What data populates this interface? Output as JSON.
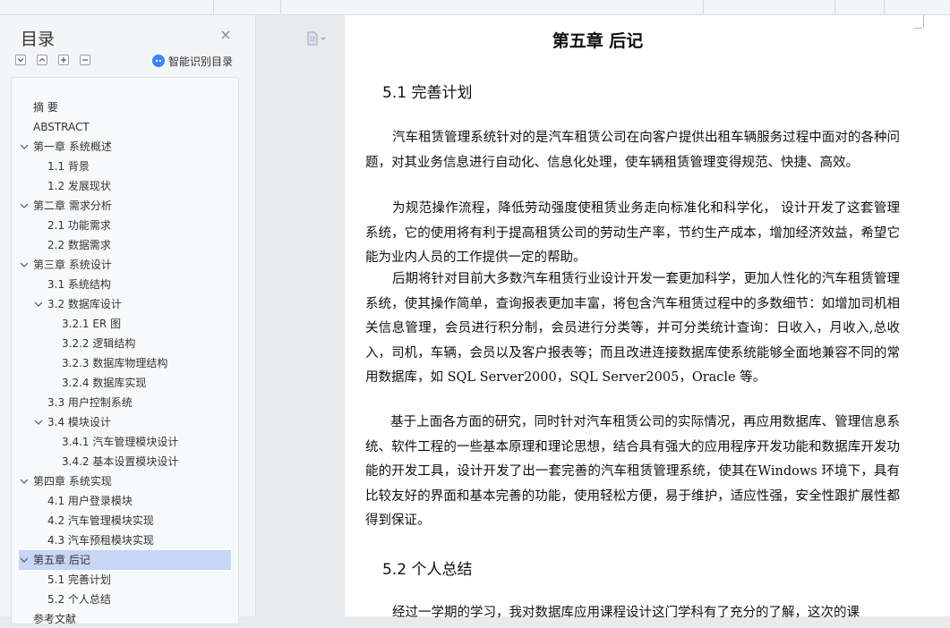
{
  "sidebar": {
    "title": "目录",
    "smart_toc_label": "智能识别目录",
    "items": [
      {
        "label": "摘    要",
        "level": 0,
        "expandable": false
      },
      {
        "label": "ABSTRACT",
        "level": 0,
        "expandable": false
      },
      {
        "label": "第一章  系统概述",
        "level": 0,
        "expandable": true
      },
      {
        "label": "1.1 背景",
        "level": 1,
        "expandable": false
      },
      {
        "label": "1.2 发展现状",
        "level": 1,
        "expandable": false
      },
      {
        "label": "第二章  需求分析",
        "level": 0,
        "expandable": true
      },
      {
        "label": "2.1  功能需求",
        "level": 1,
        "expandable": false
      },
      {
        "label": "2.2  数据需求",
        "level": 1,
        "expandable": false
      },
      {
        "label": "第三章  系统设计",
        "level": 0,
        "expandable": true
      },
      {
        "label": "3.1 系统结构",
        "level": 1,
        "expandable": false
      },
      {
        "label": "3.2  数据库设计",
        "level": 1,
        "expandable": true
      },
      {
        "label": "3.2.1 ER 图",
        "level": 2,
        "expandable": false
      },
      {
        "label": "3.2.2  逻辑结构",
        "level": 2,
        "expandable": false
      },
      {
        "label": "3.2.3  数据库物理结构",
        "level": 2,
        "expandable": false
      },
      {
        "label": "3.2.4  数据库实现",
        "level": 2,
        "expandable": false
      },
      {
        "label": "3.3 用户控制系统",
        "level": 1,
        "expandable": false
      },
      {
        "label": "3.4 模块设计",
        "level": 1,
        "expandable": true
      },
      {
        "label": "3.4.1  汽车管理模块设计",
        "level": 2,
        "expandable": false
      },
      {
        "label": "3.4.2  基本设置模块设计",
        "level": 2,
        "expandable": false
      },
      {
        "label": "第四章  系统实现",
        "level": 0,
        "expandable": true
      },
      {
        "label": "4.1 用户登录模块",
        "level": 1,
        "expandable": false
      },
      {
        "label": "4.2 汽车管理模块实现",
        "level": 1,
        "expandable": false
      },
      {
        "label": "4.3 汽车预租模块实现",
        "level": 1,
        "expandable": false
      },
      {
        "label": "第五章  后记",
        "level": 0,
        "expandable": true,
        "active": true
      },
      {
        "label": "5.1 完善计划",
        "level": 1,
        "expandable": false
      },
      {
        "label": "5.2 个人总结",
        "level": 1,
        "expandable": false
      },
      {
        "label": "参考文献",
        "level": 0,
        "expandable": false
      }
    ]
  },
  "document": {
    "chapter_title": "第五章  后记",
    "sec1_title": "5.1 完善计划",
    "para1": "汽车租赁管理系统针对的是汽车租赁公司在向客户提供出租车辆服务过程中面对的各种问题，对其业务信息进行自动化、信息化处理，使车辆租赁管理变得规范、快捷、高效。",
    "para2": "为规范操作流程，降低劳动强度使租赁业务走向标准化和科学化，  设计开发了这套管理系统，它的使用将有利于提高租赁公司的劳动生产率，节约生产成本，增加经济效益，希望它能为业内人员的工作提供一定的帮助。",
    "para3": "后期将针对目前大多数汽车租赁行业设计开发一套更加科学，更加人性化的汽车租赁管理系统，使其操作简单，查询报表更加丰富，将包含汽车租赁过程中的多数细节：如增加司机相关信息管理，会员进行积分制，会员进行分类等，并可分类统计查询：日收入，月收入,总收入，司机，车辆，会员以及客户报表等；而且改进连接数据库使系统能够全面地兼容不同的常用数据库，如 SQL Server2000，SQL Server2005，Oracle 等。",
    "para4": "基于上面各方面的研究，同时针对汽车租赁公司的实际情况，再应用数据库、管理信息系统、软件工程的一些基本原理和理论思想，结合具有强大的应用程序开发功能和数据库开发功能的开发工具，设计开发了出一套完善的汽车租赁管理系统，使其在Windows 环境下，具有比较友好的界面和基本完善的功能，使用轻松方便，易于维护，适应性强，安全性跟扩展性都得到保证。",
    "sec2_title": "5.2 个人总结",
    "para5": "经过一学期的学习，我对数据库应用课程设计这门学科有了充分的了解，这次的课"
  }
}
